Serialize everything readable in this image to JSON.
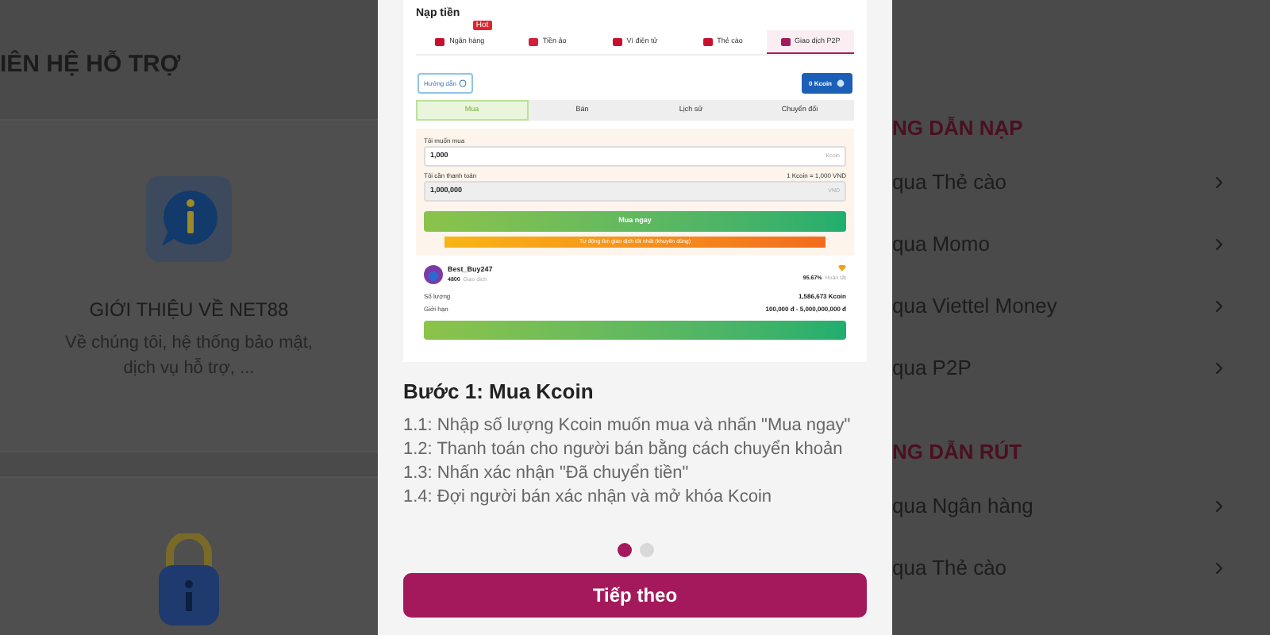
{
  "background": {
    "section_title": "IÊN HỆ HỖ TRỢ",
    "about_card": {
      "title": "GIỚI THIỆU VỀ NET88",
      "description": "Về chúng tôi, hệ thống bảo mật, dịch vụ hỗ trợ, ..."
    },
    "guides": [
      {
        "heading": "NG DẪN NẠP",
        "items": [
          "qua Thẻ cào",
          "qua Momo",
          "qua Viettel Money",
          "qua P2P"
        ]
      },
      {
        "heading": "NG DẪN RÚT",
        "items": [
          "qua Ngân hàng",
          "qua Thẻ cào"
        ]
      }
    ]
  },
  "modal": {
    "screenshot": {
      "title": "Nạp tiền",
      "tabs": [
        {
          "label": "Ngân hàng",
          "selected": false,
          "badge": "Hot"
        },
        {
          "label": "Tiền ảo",
          "selected": false
        },
        {
          "label": "Ví điện tử",
          "selected": false
        },
        {
          "label": "Thẻ cào",
          "selected": false
        },
        {
          "label": "Giao dịch P2P",
          "selected": true
        }
      ],
      "guide_button": "Hướng dẫn",
      "balance_button": "0 Kcoin",
      "segments": [
        {
          "label": "Mua",
          "selected": true
        },
        {
          "label": "Bán",
          "selected": false
        },
        {
          "label": "Lịch sử",
          "selected": false
        },
        {
          "label": "Chuyển đổi",
          "selected": false
        }
      ],
      "buy_form": {
        "amount_label": "Tôi muốn mua",
        "amount_value": "1,000",
        "amount_unit": "Kcoin",
        "pay_label": "Tôi cần thanh toán",
        "rate": "1 Kcoin = 1,000 VND",
        "pay_value": "1,000,000",
        "pay_unit": "VND",
        "buy_button": "Mua ngay",
        "auto_hint": "Tự động tìm giao dịch tốt nhất (khuyên dùng)"
      },
      "seller": {
        "name": "Best_Buy247",
        "trades": "4800",
        "trades_label": "Giao dịch",
        "rate": "95.67%",
        "rate_label": "Hoàn tất",
        "quantity_label": "Số lượng",
        "quantity": "1,586,673 Kcoin",
        "limit_label": "Giới hạn",
        "limit": "100,000 đ - 5,000,000,000 đ"
      }
    },
    "step_title": "Bước 1: Mua Kcoin",
    "steps": [
      "1.1: Nhập số lượng Kcoin muốn mua và nhấn \"Mua ngay\"",
      "1.2: Thanh toán cho người bán bằng cách chuyển khoản",
      "1.3: Nhấn xác nhận \"Đã chuyển tiền\"",
      "1.4: Đợi người bán xác nhận và mở khóa Kcoin"
    ],
    "dots": [
      {
        "selected": true
      },
      {
        "selected": false
      }
    ],
    "next_button": "Tiếp theo"
  }
}
